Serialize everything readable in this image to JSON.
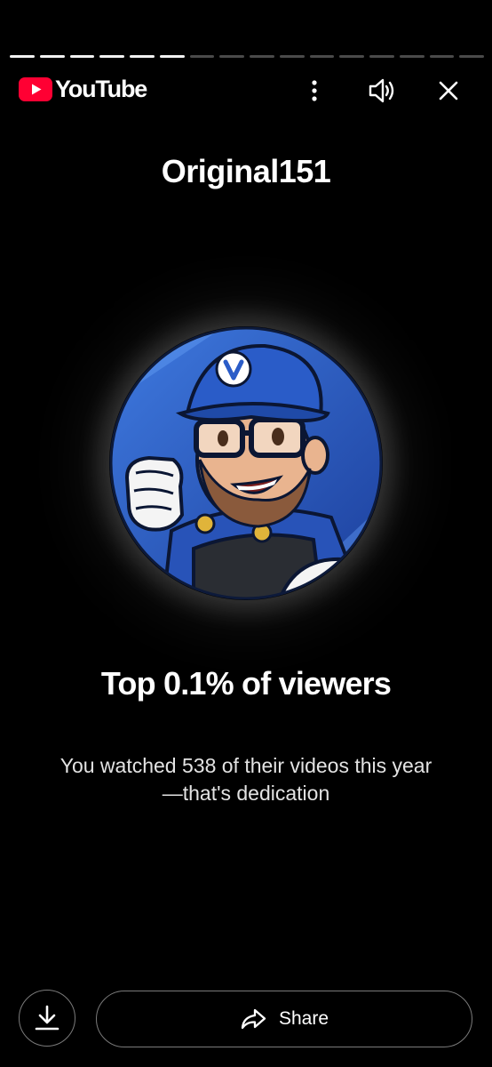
{
  "progress": {
    "total_segments": 16,
    "completed_segments": 6
  },
  "header": {
    "brand": "YouTube",
    "icons": {
      "logo": "youtube-play-icon",
      "more": "more-vertical-icon",
      "volume": "volume-icon",
      "close": "close-icon"
    }
  },
  "channel": {
    "name": "Original151"
  },
  "stat": {
    "headline": "Top 0.1% of viewers",
    "detail": "You watched 538 of their videos this year—that's dedication"
  },
  "actions": {
    "share_label": "Share",
    "download_icon": "download-icon",
    "share_icon": "share-arrow-icon"
  },
  "colors": {
    "brand_red": "#ff0033",
    "background": "#000000",
    "text": "#ffffff",
    "avatar_blue": "#2f5fc4"
  }
}
